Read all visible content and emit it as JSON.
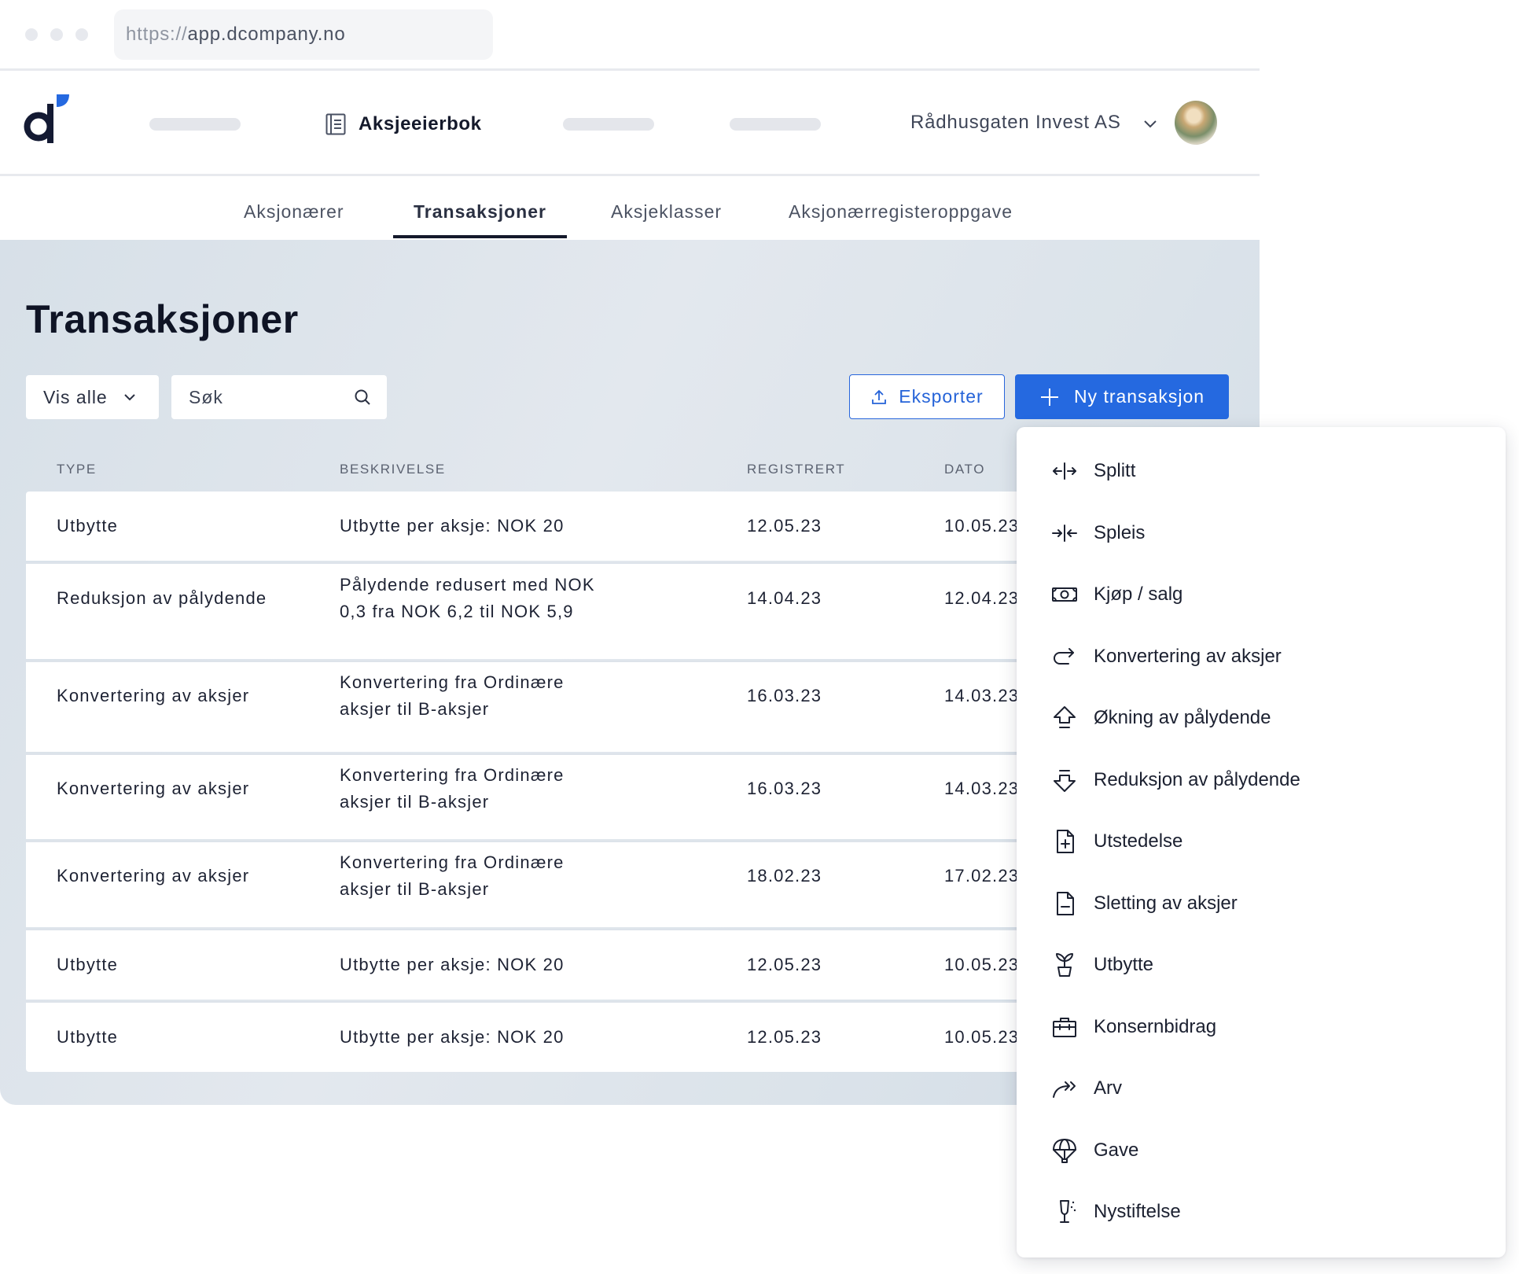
{
  "browser": {
    "url_protocol": "https://",
    "url_host": "app.dcompany.no"
  },
  "header": {
    "nav_active_label": "Aksjeeierbok",
    "company_name": "Rådhusgaten Invest AS"
  },
  "tabs": [
    {
      "label": "Aksjonærer",
      "active": false
    },
    {
      "label": "Transaksjoner",
      "active": true
    },
    {
      "label": "Aksjeklasser",
      "active": false
    },
    {
      "label": "Aksjonærregisteroppgave",
      "active": false
    }
  ],
  "page": {
    "title": "Transaksjoner",
    "filter_label": "Vis alle",
    "search_placeholder": "Søk",
    "export_label": "Eksporter",
    "new_label": "Ny transaksjon"
  },
  "table": {
    "headers": [
      "TYPE",
      "BESKRIVELSE",
      "REGISTRERT",
      "DATO"
    ],
    "rows": [
      {
        "type": "Utbytte",
        "desc": [
          "Utbytte per aksje: NOK 20"
        ],
        "registrert": "12.05.23",
        "dato": "10.05.23"
      },
      {
        "type": "Reduksjon av pålydende",
        "desc": [
          "Pålydende redusert med NOK",
          "0,3 fra NOK 6,2 til NOK 5,9"
        ],
        "registrert": "14.04.23",
        "dato": "12.04.23"
      },
      {
        "type": "Konvertering av aksjer",
        "desc": [
          "Konvertering fra Ordinære",
          "aksjer til B-aksjer"
        ],
        "registrert": "16.03.23",
        "dato": "14.03.23"
      },
      {
        "type": "Konvertering av aksjer",
        "desc": [
          "Konvertering fra Ordinære",
          "aksjer til B-aksjer"
        ],
        "registrert": "16.03.23",
        "dato": "14.03.23"
      },
      {
        "type": "Konvertering av aksjer",
        "desc": [
          "Konvertering fra Ordinære",
          "aksjer til B-aksjer"
        ],
        "registrert": "18.02.23",
        "dato": "17.02.23"
      },
      {
        "type": "Utbytte",
        "desc": [
          "Utbytte per aksje: NOK 20"
        ],
        "registrert": "12.05.23",
        "dato": "10.05.23"
      },
      {
        "type": "Utbytte",
        "desc": [
          "Utbytte per aksje: NOK 20"
        ],
        "registrert": "12.05.23",
        "dato": "10.05.23"
      }
    ]
  },
  "menu": {
    "items": [
      {
        "label": "Splitt",
        "icon": "split-arrows-icon"
      },
      {
        "label": "Spleis",
        "icon": "merge-arrows-icon"
      },
      {
        "label": "Kjøp / salg",
        "icon": "banknote-icon"
      },
      {
        "label": "Konvertering av aksjer",
        "icon": "redo-arrow-icon"
      },
      {
        "label": "Økning av pålydende",
        "icon": "arrow-up-outline-icon"
      },
      {
        "label": "Reduksjon av pålydende",
        "icon": "arrow-down-outline-icon"
      },
      {
        "label": "Utstedelse",
        "icon": "file-plus-icon"
      },
      {
        "label": "Sletting av aksjer",
        "icon": "file-minus-icon"
      },
      {
        "label": "Utbytte",
        "icon": "plant-pot-icon"
      },
      {
        "label": "Konsernbidrag",
        "icon": "briefcase-icon"
      },
      {
        "label": "Arv",
        "icon": "share-arrows-icon"
      },
      {
        "label": "Gave",
        "icon": "parachute-icon"
      },
      {
        "label": "Nystiftelse",
        "icon": "champagne-glass-icon"
      }
    ]
  },
  "colors": {
    "primary": "#2569e0",
    "text": "#14192b",
    "background": "#dbe3ea"
  }
}
